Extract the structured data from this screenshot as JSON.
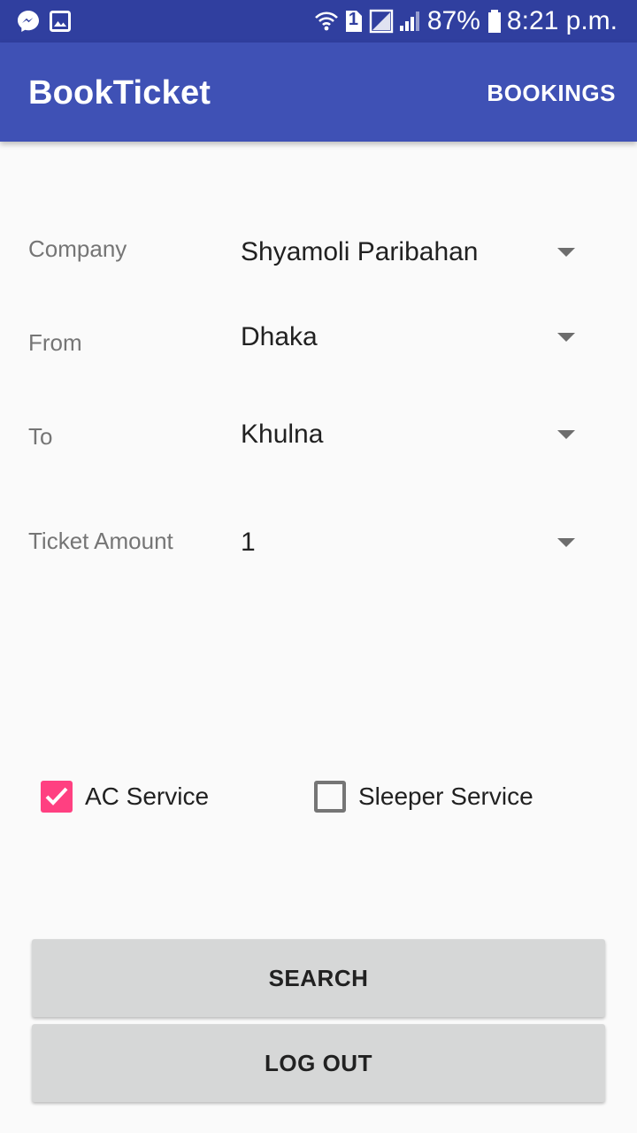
{
  "status_bar": {
    "battery": "87%",
    "time": "8:21 p.m.",
    "sim_slot": "1",
    "left_icons": [
      "messenger-icon",
      "image-icon"
    ],
    "right_icons": [
      "wifi-icon",
      "sim-icon",
      "no-signal-icon",
      "signal-icon",
      "battery-icon"
    ]
  },
  "app_bar": {
    "title": "BookTicket",
    "action_label": "BOOKINGS"
  },
  "form": {
    "company": {
      "label": "Company",
      "value": "Shyamoli Paribahan"
    },
    "from": {
      "label": "From",
      "value": "Dhaka"
    },
    "to": {
      "label": "To",
      "value": "Khulna"
    },
    "ticket_amount": {
      "label": "Ticket Amount",
      "value": "1"
    }
  },
  "options": {
    "ac_service": {
      "label": "AC Service",
      "checked": true
    },
    "sleeper_service": {
      "label": "Sleeper Service",
      "checked": false
    }
  },
  "buttons": {
    "search": "SEARCH",
    "logout": "LOG OUT"
  },
  "colors": {
    "status_bar": "#303f9f",
    "app_bar": "#3f51b5",
    "accent": "#ff4081",
    "background": "#fafafa",
    "button": "#d6d7d7"
  }
}
